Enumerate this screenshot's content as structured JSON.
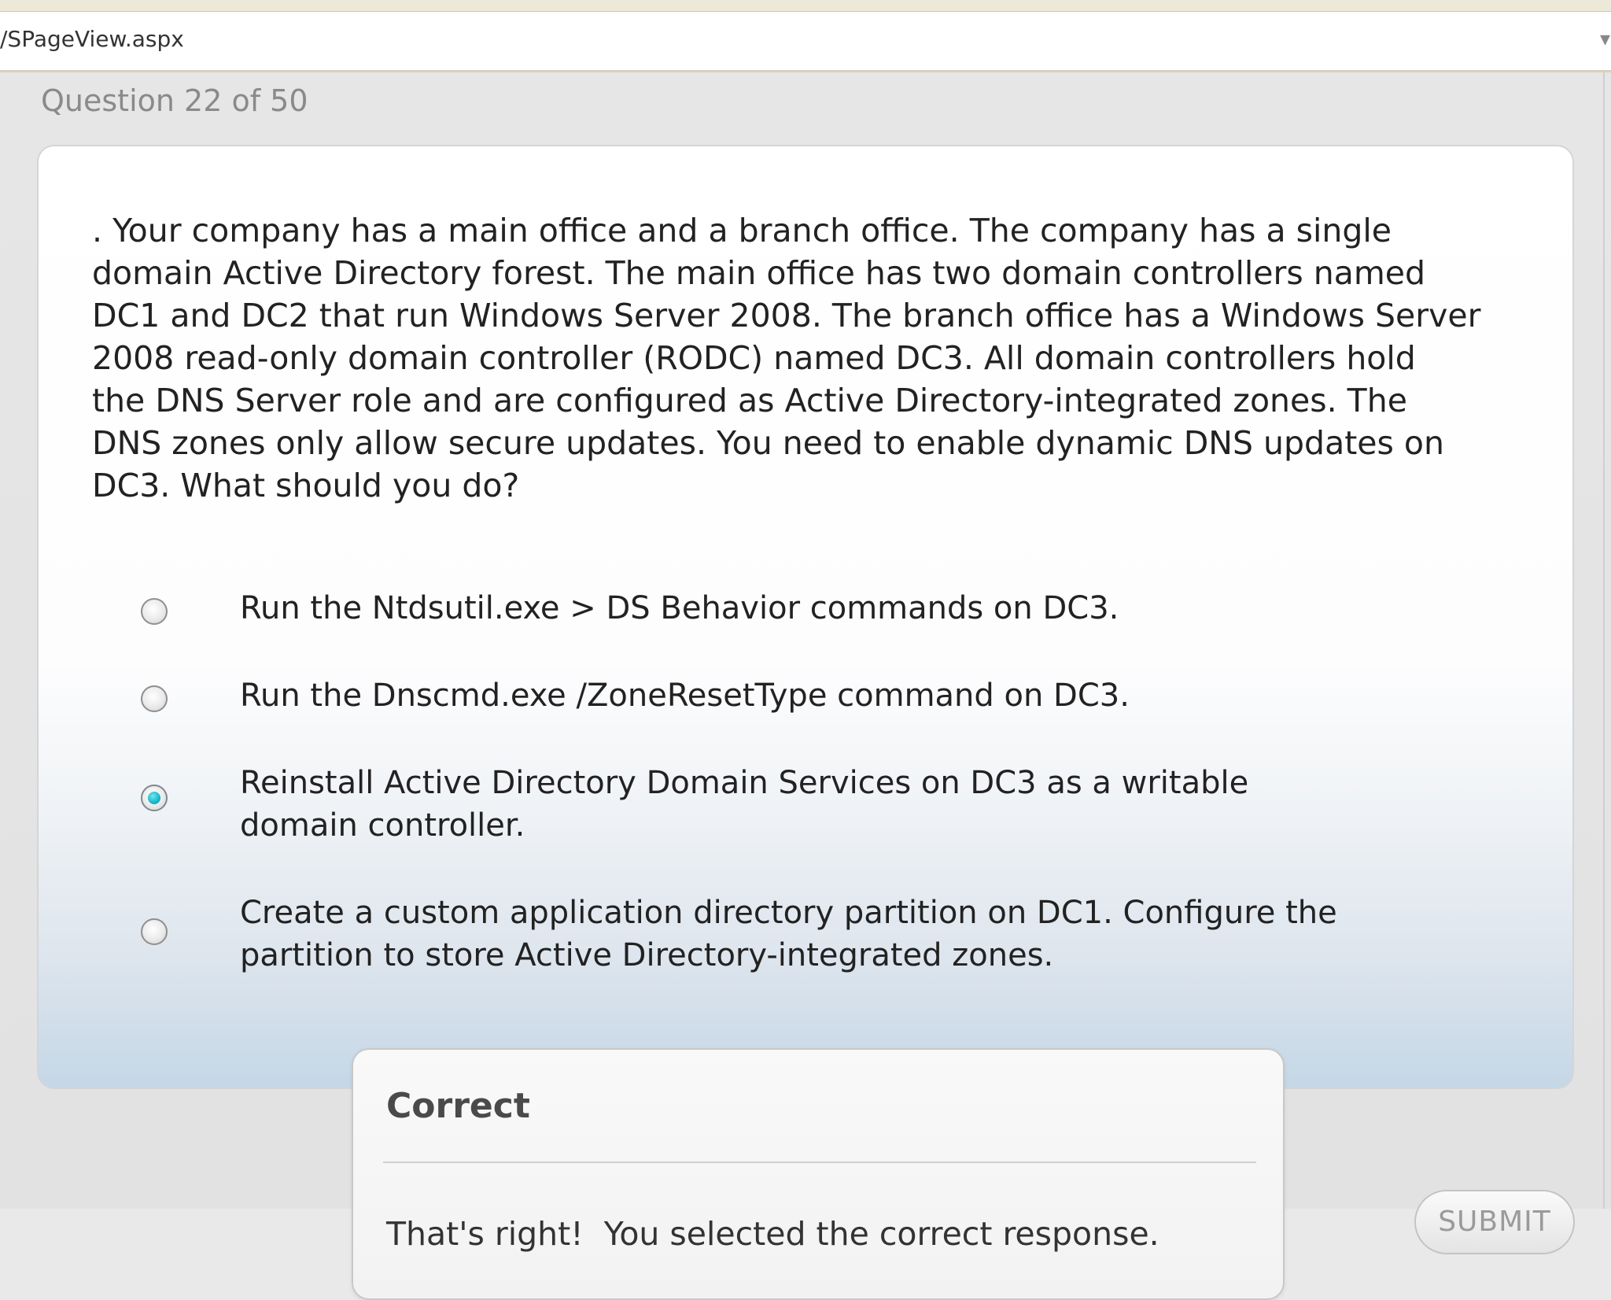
{
  "browser": {
    "address_text": "/SPageView.aspx"
  },
  "quiz": {
    "counter": "Question 22 of 50",
    "question_text": ". Your company has a main office and a branch office. The company has a single\ndomain Active Directory forest. The main office has two domain controllers named\nDC1 and DC2 that run Windows Server 2008. The branch office has a Windows Server\n2008 read-only domain controller (RODC) named DC3. All domain controllers hold\nthe DNS Server role and are configured as Active Directory-integrated zones. The\nDNS zones only allow secure updates. You need to enable dynamic DNS updates on\nDC3. What should you do?",
    "options": [
      {
        "label": "Run the Ntdsutil.exe > DS Behavior commands on DC3.",
        "selected": false
      },
      {
        "label": "Run the Dnscmd.exe /ZoneResetType command on DC3.",
        "selected": false
      },
      {
        "label": "Reinstall Active Directory Domain Services on DC3 as a writable domain controller.",
        "selected": true
      },
      {
        "label": "Create a custom application directory partition on DC1. Configure the partition to store Active Directory-integrated zones.",
        "selected": false
      }
    ],
    "selected_color": "#17b6c9"
  },
  "feedback": {
    "title": "Correct",
    "message": "That's right!  You selected the correct response."
  },
  "actions": {
    "submit_label": "SUBMIT"
  }
}
